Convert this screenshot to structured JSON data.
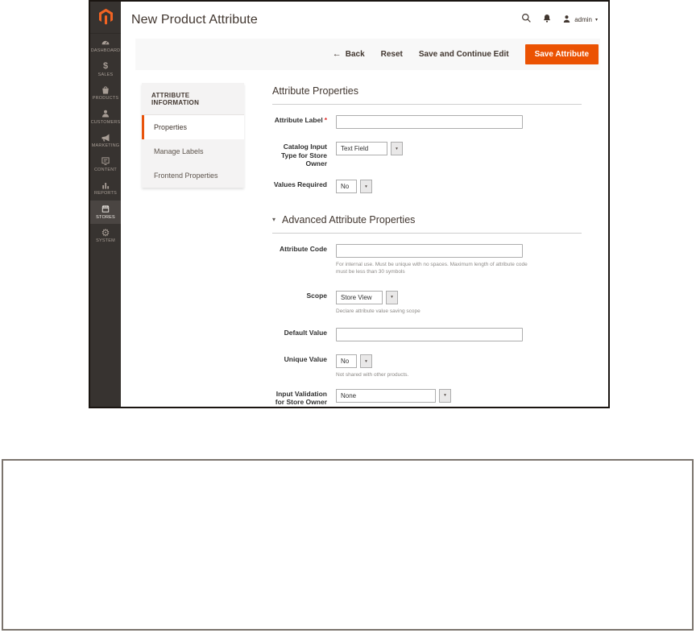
{
  "colors": {
    "accent": "#eb5202",
    "sidebar_bg": "#373330",
    "sidebar_active_bg": "#4a4542",
    "logo_orange": "#f26322",
    "required_red": "#e02b27"
  },
  "glyphs": {
    "back_arrow": "←",
    "caret_down": "▾",
    "required_marker": "*",
    "dollar": "$",
    "gear": "⚙"
  },
  "sidebar": {
    "items": [
      {
        "id": "dashboard",
        "label": "DASHBOARD",
        "icon": "dashboard-gauge-icon"
      },
      {
        "id": "sales",
        "label": "SALES",
        "icon": "dollar-icon"
      },
      {
        "id": "products",
        "label": "PRODUCTS",
        "icon": "bag-icon"
      },
      {
        "id": "customers",
        "label": "CUSTOMERS",
        "icon": "person-icon"
      },
      {
        "id": "marketing",
        "label": "MARKETING",
        "icon": "megaphone-icon"
      },
      {
        "id": "content",
        "label": "CONTENT",
        "icon": "monitor-icon"
      },
      {
        "id": "reports",
        "label": "REPORTS",
        "icon": "bar-chart-icon"
      },
      {
        "id": "stores",
        "label": "STORES",
        "icon": "storefront-icon",
        "active": true
      },
      {
        "id": "system",
        "label": "SYSTEM",
        "icon": "gear-icon"
      }
    ]
  },
  "header": {
    "title": "New Product Attribute",
    "user": "admin",
    "icons": [
      "search-icon",
      "bell-icon",
      "user-icon"
    ]
  },
  "actions": {
    "back": "Back",
    "reset": "Reset",
    "save_continue": "Save and Continue Edit",
    "save": "Save Attribute"
  },
  "left_nav": {
    "header": "ATTRIBUTE INFORMATION",
    "items": [
      {
        "label": "Properties",
        "active": true
      },
      {
        "label": "Manage Labels",
        "active": false
      },
      {
        "label": "Frontend Properties",
        "active": false
      }
    ]
  },
  "form": {
    "sections": [
      {
        "title": "Attribute Properties",
        "fields": [
          {
            "label": "Attribute Label",
            "type": "text",
            "value": "",
            "required": true
          },
          {
            "label": "Catalog Input Type for Store Owner",
            "type": "select",
            "value": "Text Field"
          },
          {
            "label": "Values Required",
            "type": "select",
            "value": "No"
          }
        ]
      },
      {
        "title": "Advanced Attribute Properties",
        "collapsible": true,
        "fields": [
          {
            "label": "Attribute Code",
            "type": "text",
            "value": "",
            "note": "For internal use. Must be unique with no spaces. Maximum length of attribute code must be less than 30 symbols"
          },
          {
            "label": "Scope",
            "type": "select",
            "value": "Store View",
            "note": "Declare attribute value saving scope"
          },
          {
            "label": "Default Value",
            "type": "text",
            "value": ""
          },
          {
            "label": "Unique Value",
            "type": "select",
            "value": "No",
            "note": "Not shared with other products."
          },
          {
            "label": "Input Validation for Store Owner",
            "type": "select",
            "value": "None"
          }
        ]
      }
    ]
  }
}
